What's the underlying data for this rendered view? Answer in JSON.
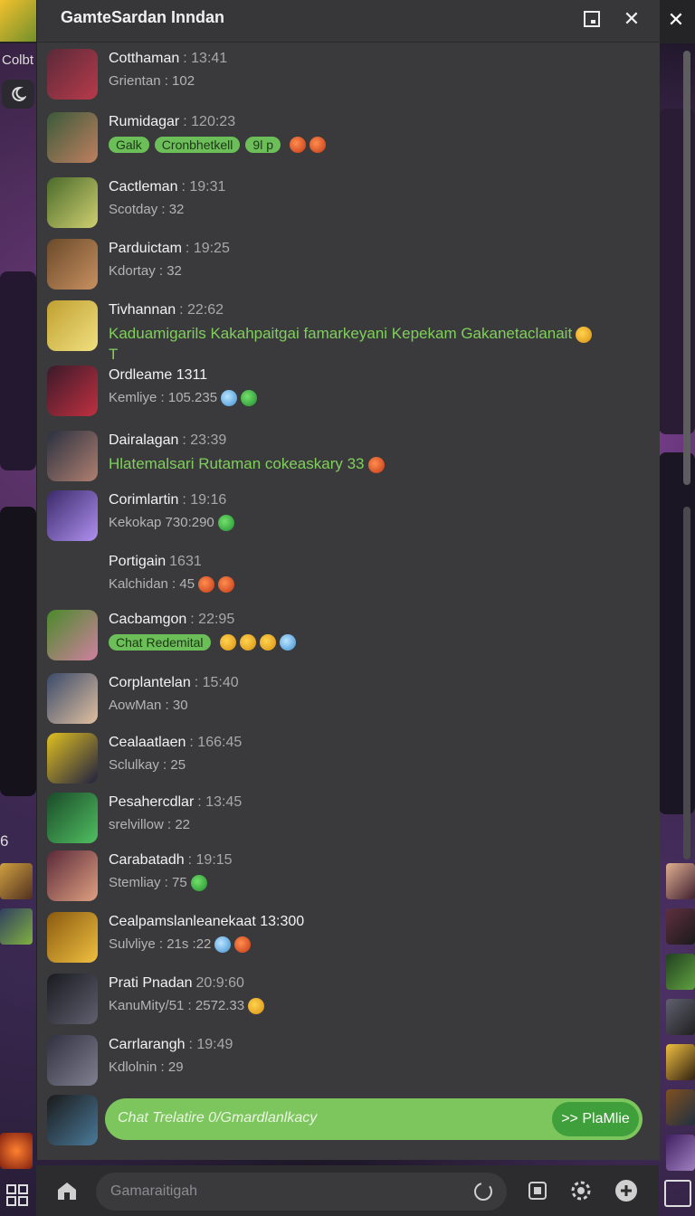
{
  "window": {
    "title": "GamteSardan Inndan"
  },
  "side": {
    "game_label": "Colbt",
    "left_count": "6"
  },
  "messages": [
    {
      "name": "Cotthaman",
      "time": ": 13:41",
      "sub": "Grientan : 102",
      "av": [
        "#5a2a3a",
        "#b83a4a"
      ]
    },
    {
      "name": "Rumidagar",
      "time": ": 120:23",
      "chips": [
        "Galk",
        "Cronbhetkell",
        "9l p"
      ],
      "av": [
        "#3a5a3a",
        "#c08060"
      ]
    },
    {
      "name": "Cactleman",
      "time": ": 19:31",
      "sub": "Scotday : 32",
      "av": [
        "#4a6a2a",
        "#cfd070"
      ]
    },
    {
      "name": "Parduictam",
      "time": ": 19:25",
      "sub": "Kdortay : 32",
      "av": [
        "#6a4a2a",
        "#c89060"
      ]
    },
    {
      "name": "Tivhannan",
      "time": ": 22:62",
      "text": "Kaduamigarils Kakahpaitgai famarkeyani Kepekam Gakanetaclanait",
      "text2": "T",
      "av": [
        "#c0a030",
        "#f0e080"
      ]
    },
    {
      "name": "Ordleame 1311",
      "time": "",
      "sub": "Kemliye : 105.235",
      "av": [
        "#3a1a2a",
        "#c03040"
      ]
    },
    {
      "name": "Dairalagan",
      "time": ": 23:39",
      "text": "Hlatemalsari Rutaman cokeaskary 33",
      "av": [
        "#2a3040",
        "#b08070"
      ]
    },
    {
      "name": "Corimlartin",
      "time": ": 19:16",
      "sub": "Kekokap 730:290",
      "av": [
        "#3a2a6a",
        "#b090f0"
      ]
    },
    {
      "name": "Portigain",
      "time": "1631",
      "sub": "Kalchidan : 45",
      "av": null
    },
    {
      "name": "Cacbamgon",
      "time": ": 22:95",
      "chips": [
        "Chat Redemital"
      ],
      "av": [
        "#4a8a2a",
        "#d080a0"
      ]
    },
    {
      "name": "Corplantelan",
      "time": ": 15:40",
      "sub": "AowMan : 30",
      "av": [
        "#3a4a6a",
        "#e0c0a0"
      ]
    },
    {
      "name": "Cealaatlaen",
      "time": ": 166:45",
      "sub": "Sclulkay : 25",
      "av": [
        "#e0c020",
        "#202040"
      ]
    },
    {
      "name": "Pesahercdlar",
      "time": ": 13:45",
      "sub": "srelvillow : 22",
      "av": [
        "#1a4a2a",
        "#50c060"
      ]
    },
    {
      "name": "Carabatadh",
      "time": ": 19:15",
      "sub": "Stemliay : 75",
      "av": [
        "#5a2a3a",
        "#e0a080"
      ]
    },
    {
      "name": "Cealpamslanleanekaat 13:300",
      "time": "",
      "sub": "Sulvliye : 21s :22",
      "av": [
        "#8a5a10",
        "#f0c040"
      ]
    },
    {
      "name": "Prati Pnadan",
      "time": "20:9:60",
      "sub": "KanuMity/51 : 2572.33",
      "av": [
        "#1a1a20",
        "#606070"
      ]
    },
    {
      "name": "Carrlarangh",
      "time": ": 19:49",
      "sub": "Kdlolnin : 29",
      "av": [
        "#303040",
        "#808090"
      ]
    }
  ],
  "compose": {
    "placeholder": "Chat Trelatire 0/Gmardlanlkacy",
    "send_label": ">> PlaMlie"
  },
  "bottom": {
    "placeholder": "Gamaraitigah"
  },
  "colors": {
    "accent": "#7cc65d",
    "send": "#3f9f3a",
    "panel": "#3a3a3c"
  }
}
